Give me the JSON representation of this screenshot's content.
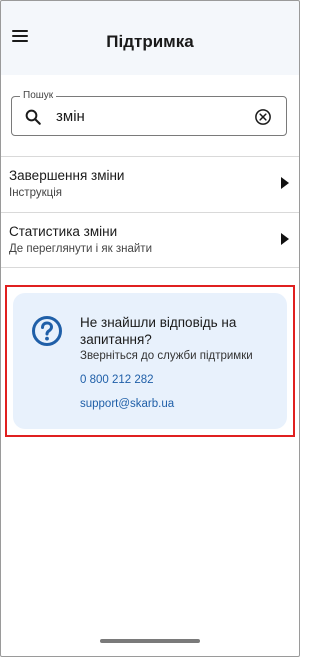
{
  "header": {
    "title": "Підтримка",
    "menu_icon": "menu-icon"
  },
  "search": {
    "label": "Пошук",
    "value": "змін",
    "search_icon": "search-icon",
    "clear_icon": "clear-circle-icon"
  },
  "results": [
    {
      "title": "Завершення зміни",
      "subtitle": "Інструкція",
      "arrow_icon": "play-arrow-icon"
    },
    {
      "title": "Статистика зміни",
      "subtitle": "Де переглянути і як знайти",
      "arrow_icon": "play-arrow-icon"
    }
  ],
  "support_card": {
    "icon": "help-circle-icon",
    "title": "Не знайшли відповідь на запитання?",
    "subtitle": "Зверніться до служби підтримки",
    "phone": "0 800 212 282",
    "email": "support@skarb.ua"
  },
  "colors": {
    "header_bg": "#f4f7fb",
    "card_bg": "#e8f1fc",
    "accent": "#1f5fa8",
    "highlight": "#e02020"
  }
}
